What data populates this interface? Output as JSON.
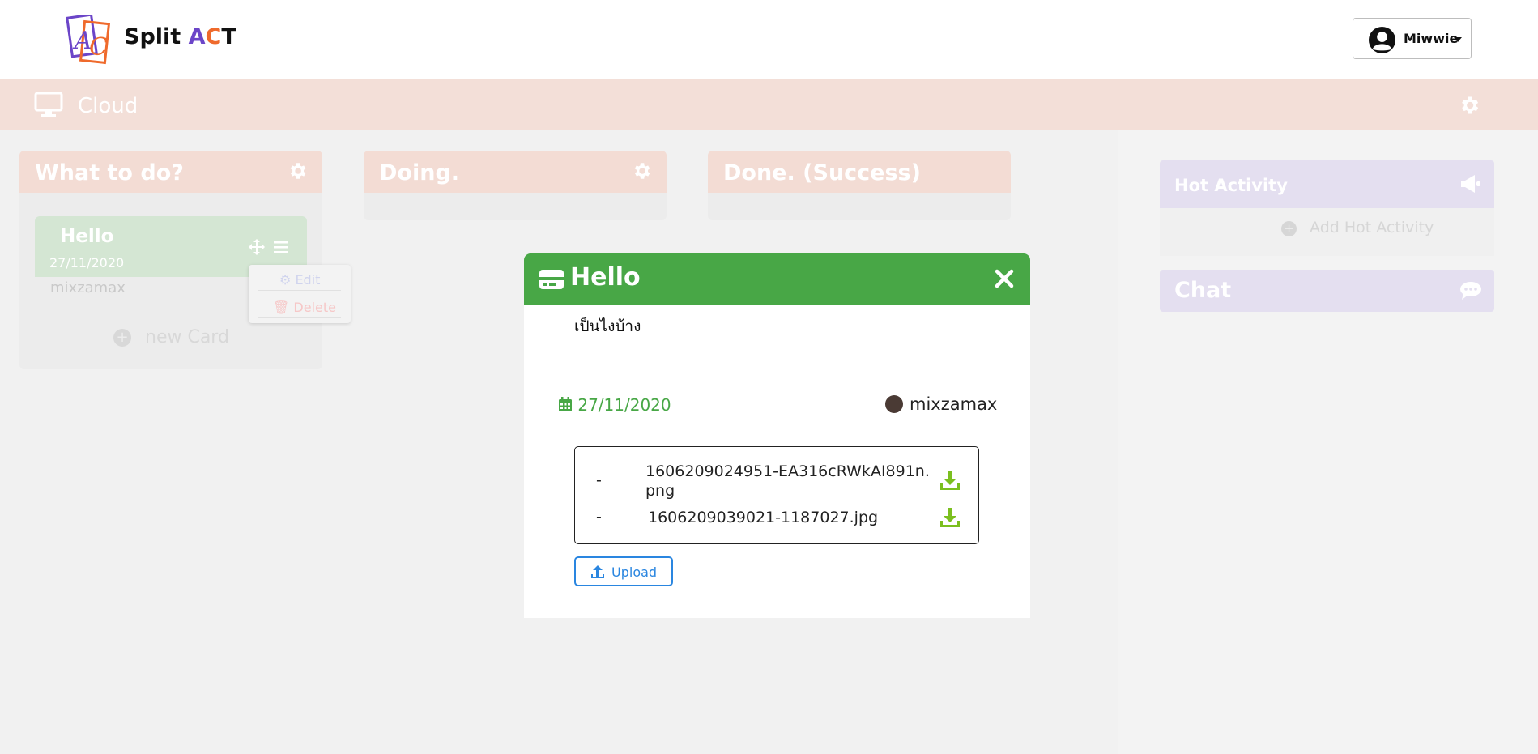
{
  "header": {
    "logo_word": "Split ",
    "logo_a": "A",
    "logo_c": "C",
    "logo_t": "T",
    "user_name": "Miwwie"
  },
  "board": {
    "title": "Cloud"
  },
  "columns": [
    {
      "title": "What to do?"
    },
    {
      "title": "Doing."
    },
    {
      "title": "Done. (Success)"
    }
  ],
  "card": {
    "title": "Hello",
    "date": "27/11/2020",
    "owner": "mixzamax",
    "new_card_label": "new Card",
    "menu": {
      "edit": "Edit",
      "delete": "Delete"
    }
  },
  "side": {
    "hot_title": "Hot Activity",
    "add_hot": "Add Hot Activity",
    "chat_title": "Chat"
  },
  "modal": {
    "title": "Hello",
    "description": "เป็นไงบ้าง",
    "date": "27/11/2020",
    "owner": "mixzamax",
    "files": [
      {
        "dash": "-",
        "name": "1606209024951-EA316cRWkAI891n.png"
      },
      {
        "dash": "-",
        "name": "1606209039021-1187027.jpg"
      }
    ],
    "upload_label": "Upload"
  },
  "colors": {
    "accent_green": "#48a746",
    "upload_blue": "#2a86e0",
    "download_green": "#7bbf1f",
    "logo_purple": "#6b45c8",
    "logo_orange": "#ef6a2c"
  }
}
